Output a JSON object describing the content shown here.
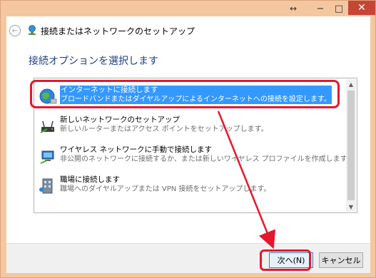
{
  "titlebar": {
    "resize_icon": "↔",
    "minimize": "−",
    "maximize": "□",
    "close": "✕"
  },
  "nav": {
    "back_icon": "←",
    "title": "接続またはネットワークのセットアップ"
  },
  "heading": "接続オプションを選択します",
  "options": [
    {
      "title": "インターネットに接続します",
      "desc": "ブロードバンドまたはダイヤルアップによるインターネットへの接続を設定します。",
      "icon": "globe-icon",
      "selected": true
    },
    {
      "title": "新しいネットワークのセットアップ",
      "desc": "新しいルーターまたはアクセス ポイントをセットアップします。",
      "icon": "router-icon",
      "selected": false
    },
    {
      "title": "ワイヤレス ネットワークに手動で接続します",
      "desc": "非公開のネットワークに接続するか、または新しいワイヤレス プロファイルを作成します。",
      "icon": "wireless-icon",
      "selected": false
    },
    {
      "title": "職場に接続します",
      "desc": "職場へのダイヤルアップまたは VPN 接続をセットアップします。",
      "icon": "workplace-icon",
      "selected": false
    }
  ],
  "buttons": {
    "next": "次へ(N)",
    "cancel": "キャンセル"
  },
  "colors": {
    "title_bar": "#f5c7a0",
    "close_button": "#c74535",
    "selection": "#3399ff",
    "annotation": "#e3182d",
    "heading": "#1e3f8a"
  }
}
